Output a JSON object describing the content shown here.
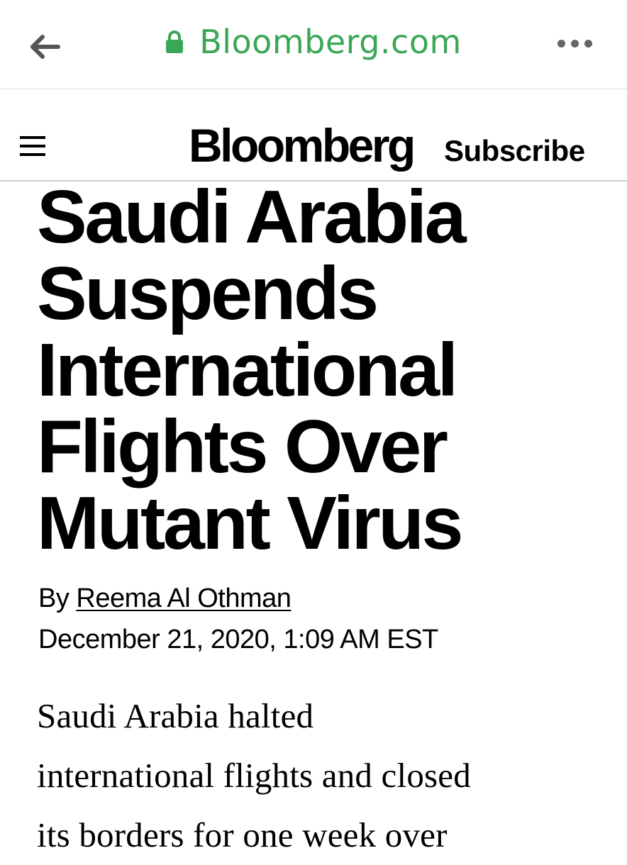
{
  "browser": {
    "url": "Bloomberg.com",
    "back_icon": "arrow-left-icon",
    "lock_icon": "lock-icon",
    "more_icon": "more-horizontal-icon",
    "url_color": "#3aa756"
  },
  "site": {
    "logo": "Bloomberg",
    "subscribe_label": "Subscribe",
    "menu_icon": "hamburger-menu-icon"
  },
  "article": {
    "headline_lines": [
      "Saudi Arabia",
      "Suspends",
      "International",
      "Flights Over",
      "Mutant Virus"
    ],
    "byline_prefix": "By",
    "author": "Reema Al Othman",
    "dateline": "December 21, 2020, 1:09 AM EST",
    "body_lines": [
      "Saudi Arabia halted",
      "international flights and closed",
      "its borders for one week over"
    ]
  }
}
